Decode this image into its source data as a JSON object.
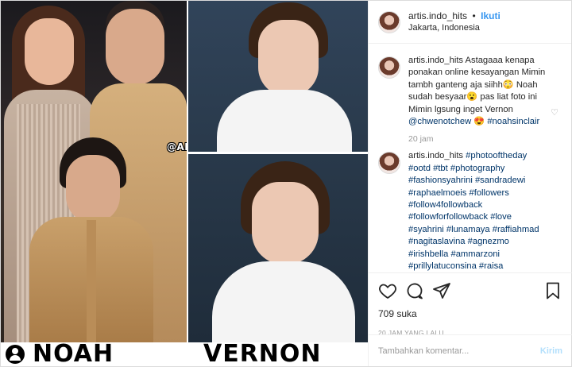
{
  "media": {
    "watermark": "@ARTIS.INDO_HITS",
    "caption_left": "NOAH",
    "caption_right": "VERNON"
  },
  "header": {
    "username": "artis.indo_hits",
    "separator": "•",
    "follow_label": "Ikuti",
    "location": "Jakarta, Indonesia"
  },
  "comments": [
    {
      "username": "artis.indo_hits",
      "text": "Astagaaa kenapa ponakan online kesayangan Mimin tambh ganteng aja siihh😳 Noah sudah besyaar😮 pas liat foto ini Mimin lgsung inget Vernon",
      "mention": "@chwenotchew",
      "emoji": "😍",
      "hashtag": "#noahsinclair",
      "time": "20 jam"
    },
    {
      "username": "artis.indo_hits",
      "hashtags": "#photooftheday #ootd #tbt #photography #fashionsyahrini #sandradewi #raphaelmoeis #followers #follow4followback #followforfollowback #love #syahrini #lunamaya #raffiahmad #nagitaslavina #agnezmo #irishbella #ammarzoni #prillylatuconsina #raisa #zaskiasungkar #natashawilona #baimwong #ririnekawati"
    }
  ],
  "actions": {
    "likes": "709 suka",
    "posted": "20 JAM YANG LALU"
  },
  "comment_box": {
    "placeholder": "Tambahkan komentar...",
    "send_label": "Kirim"
  },
  "colors": {
    "accent": "#3897f0",
    "hashtag": "#003569",
    "muted": "#999999"
  }
}
